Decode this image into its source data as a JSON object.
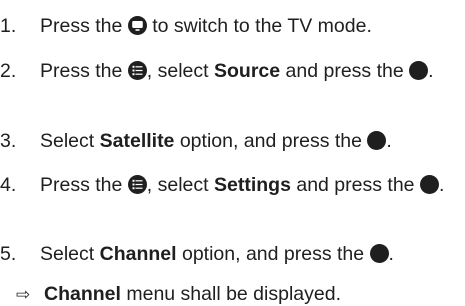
{
  "steps": [
    {
      "number": "1.",
      "before_icon": "Press the ",
      "icon": "tv-mode-button",
      "after_icon": " to switch to the TV mode."
    },
    {
      "number": "2.",
      "before_icon": "Press the ",
      "icon": "menu-button",
      "mid": ", select ",
      "bold": "Source",
      "after_bold": " and press the ",
      "icon2": "ok-button",
      "end": "."
    },
    {
      "number": "3.",
      "before_bold": "Select ",
      "bold": "Satellite",
      "after_bold": " option, and press the ",
      "icon": "ok-button",
      "end": "."
    },
    {
      "number": "4.",
      "before_icon": "Press the ",
      "icon": "menu-button",
      "mid": ", select ",
      "bold": "Settings",
      "after_bold": " and press the ",
      "icon2": "ok-button",
      "end": "."
    },
    {
      "number": "5.",
      "before_bold": "Select ",
      "bold": "Channel",
      "after_bold": " option, and press the ",
      "icon": "ok-button",
      "end": "."
    }
  ],
  "result": {
    "arrow": "⇨",
    "bold": "Channel",
    "text": " menu shall be displayed."
  }
}
